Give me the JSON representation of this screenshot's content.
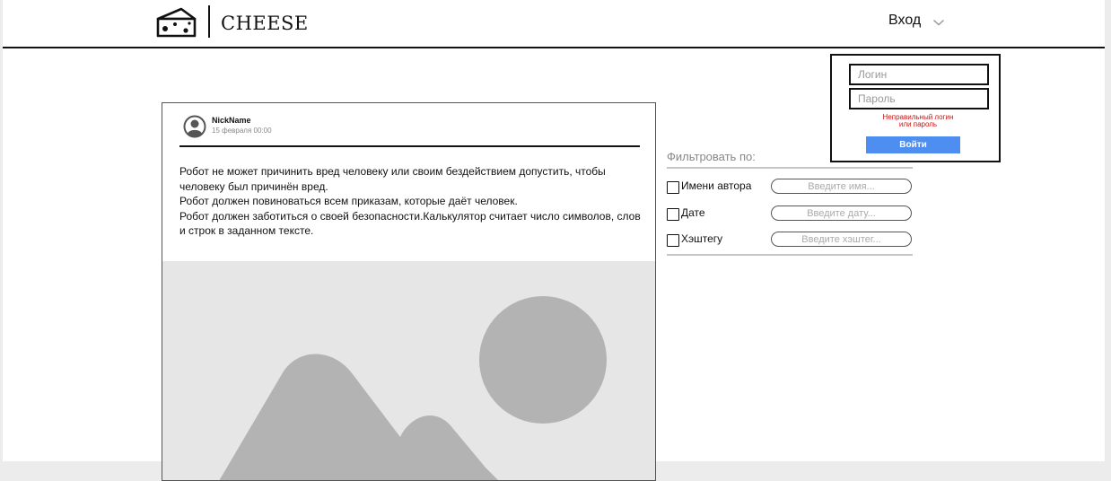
{
  "header": {
    "brand": "CHEESE",
    "login_label": "Вход",
    "logo_icon": "cheese-icon",
    "dropdown_icon": "chevron-down-icon"
  },
  "login_popup": {
    "login_placeholder": "Логин",
    "password_placeholder": "Пароль",
    "error_line1": "Неправильный логин",
    "error_line2": "или пароль",
    "submit_label": "Войти",
    "accent_color": "#4d8ef0",
    "error_color": "#cc1111"
  },
  "post": {
    "author": "NickName",
    "date": "15 февраля 00:00",
    "avatar_icon": "user-avatar-icon",
    "image_icon": "image-placeholder-icon",
    "paragraphs": [
      "Робот не может причинить вред человеку или своим бездействием допустить, чтобы человеку был причинён вред.",
      "Робот должен повиноваться всем приказам, которые даёт человек.",
      "Робот должен заботиться о своей безопасности.Калькулятор считает число символов, слов и строк в заданном тексте."
    ]
  },
  "filters": {
    "title": "Фильтровать по:",
    "items": [
      {
        "label": "Имени автора",
        "placeholder": "Введите имя..."
      },
      {
        "label": "Дате",
        "placeholder": "Введите дату..."
      },
      {
        "label": "Хэштегу",
        "placeholder": "Введите хэштег..."
      }
    ]
  }
}
